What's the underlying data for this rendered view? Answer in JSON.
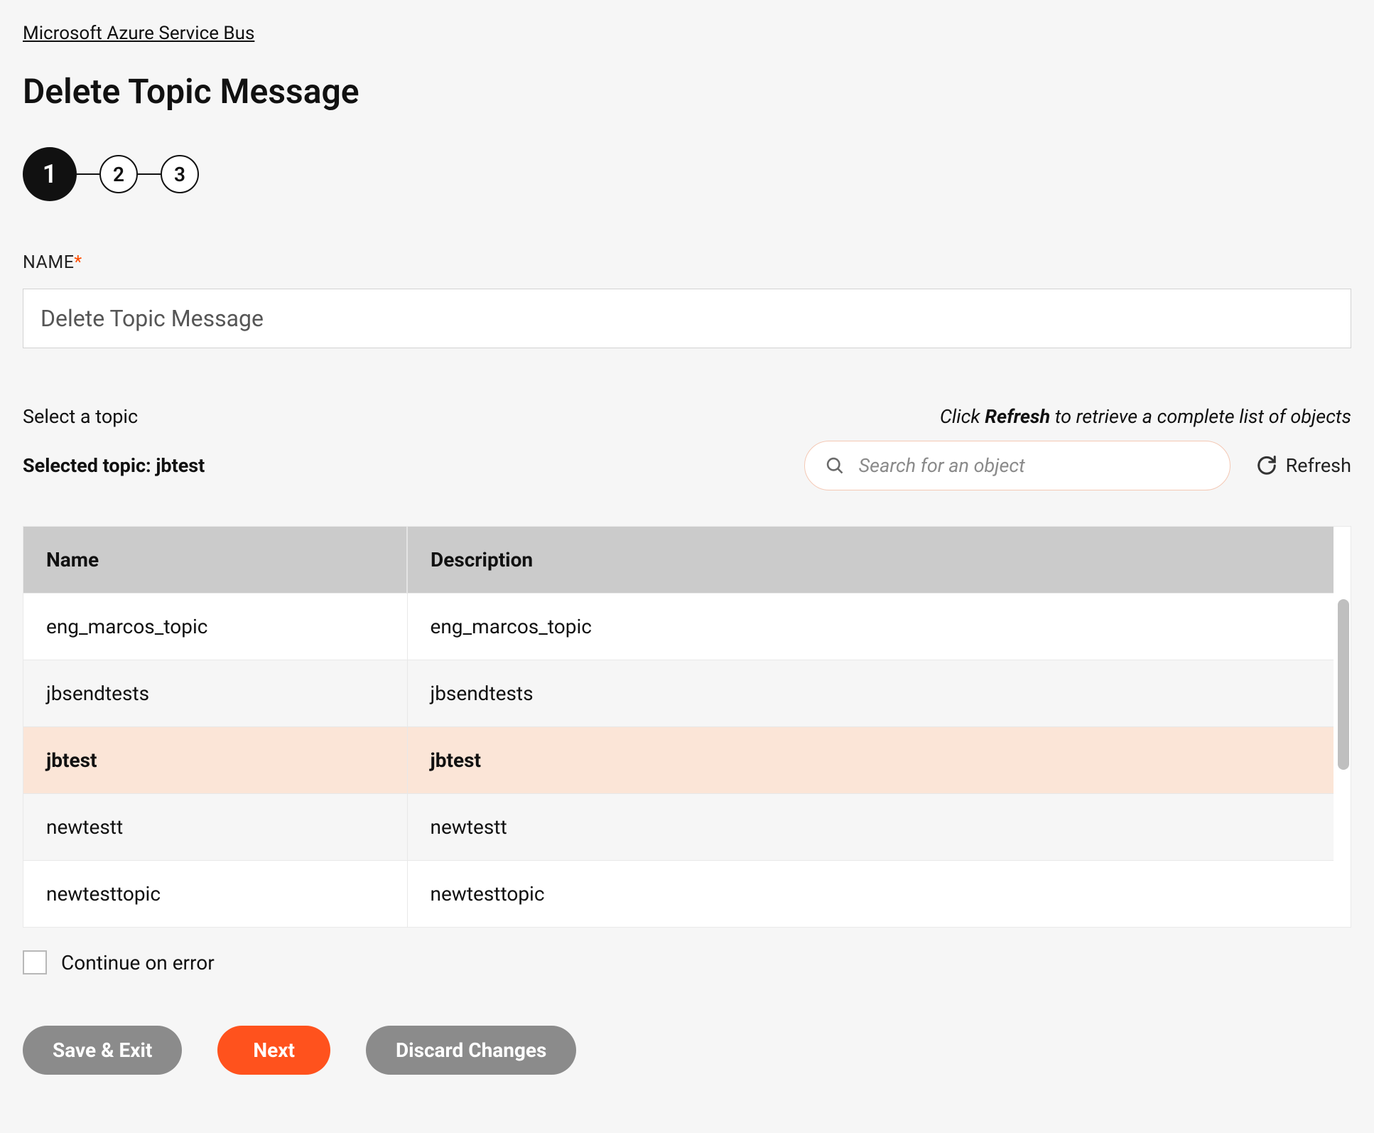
{
  "breadcrumb": "Microsoft Azure Service Bus",
  "page_title": "Delete Topic Message",
  "stepper": {
    "steps": [
      "1",
      "2",
      "3"
    ],
    "active_index": 0
  },
  "name_field": {
    "label": "NAME",
    "value": "Delete Topic Message"
  },
  "topic_section": {
    "select_label": "Select a topic",
    "refresh_hint_prefix": "Click ",
    "refresh_hint_bold": "Refresh",
    "refresh_hint_suffix": " to retrieve a complete list of objects",
    "selected_label": "Selected topic: jbtest",
    "search_placeholder": "Search for an object",
    "refresh_label": "Refresh"
  },
  "table": {
    "headers": {
      "name": "Name",
      "description": "Description"
    },
    "rows": [
      {
        "name": "eng_marcos_topic",
        "description": "eng_marcos_topic",
        "selected": false
      },
      {
        "name": "jbsendtests",
        "description": "jbsendtests",
        "selected": false
      },
      {
        "name": "jbtest",
        "description": "jbtest",
        "selected": true
      },
      {
        "name": "newtestt",
        "description": "newtestt",
        "selected": false
      },
      {
        "name": "newtesttopic",
        "description": "newtesttopic",
        "selected": false
      }
    ]
  },
  "continue_on_error_label": "Continue on error",
  "buttons": {
    "save_exit": "Save & Exit",
    "next": "Next",
    "discard": "Discard Changes"
  }
}
